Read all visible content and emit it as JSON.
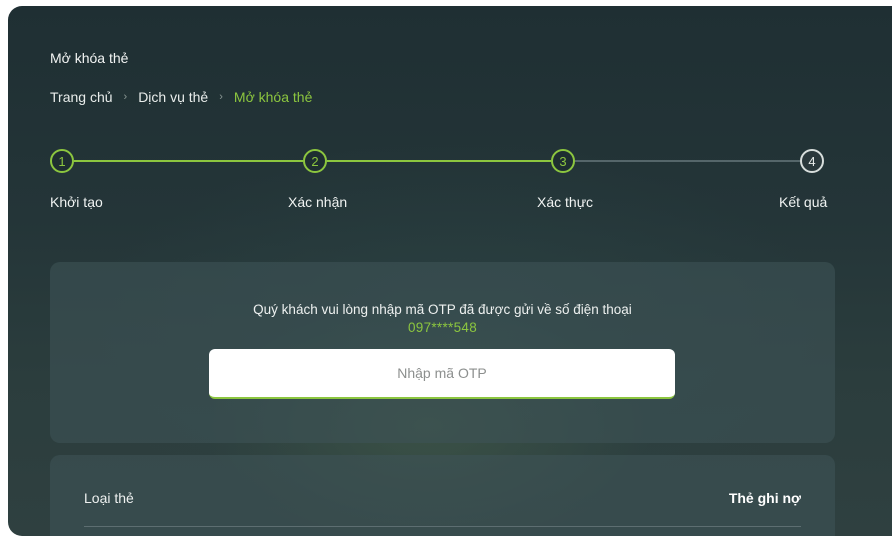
{
  "page": {
    "title": "Mở khóa thẻ"
  },
  "breadcrumb": {
    "items": [
      {
        "label": "Trang chủ"
      },
      {
        "label": "Dịch vụ thẻ"
      },
      {
        "label": "Mở khóa thẻ"
      }
    ],
    "separator": "›"
  },
  "stepper": {
    "steps": [
      {
        "number": "1",
        "label": "Khởi tạo",
        "status": "done"
      },
      {
        "number": "2",
        "label": "Xác nhận",
        "status": "done"
      },
      {
        "number": "3",
        "label": "Xác thực",
        "status": "active"
      },
      {
        "number": "4",
        "label": "Kết quả",
        "status": "pending"
      }
    ]
  },
  "otp": {
    "message": "Quý khách vui lòng nhập mã OTP đã được gửi về số điện thoại",
    "phone": "097****548",
    "placeholder": "Nhập mã OTP",
    "value": ""
  },
  "card_info": {
    "rows": [
      {
        "label": "Loại thẻ",
        "value": "Thẻ ghi nợ"
      }
    ]
  },
  "colors": {
    "accent": "#8cc63f",
    "background": "#243538",
    "pending": "#d8dedc"
  }
}
